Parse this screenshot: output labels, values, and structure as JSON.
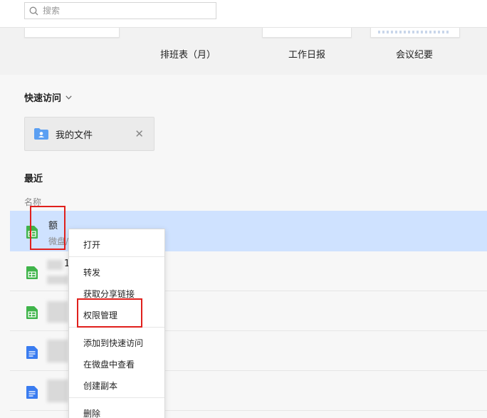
{
  "search": {
    "placeholder": "搜索"
  },
  "templates": [
    {
      "label": "排班表（月）"
    },
    {
      "label": "工作日报"
    },
    {
      "label": "会议纪要"
    }
  ],
  "quick_access": {
    "title": "快速访问",
    "items": [
      {
        "name": "我的文件"
      }
    ]
  },
  "recent": {
    "title": "最近",
    "column_name": "名称",
    "files": [
      {
        "name": "额",
        "location": "微盘/",
        "type": "sheet"
      },
      {
        "name": "1",
        "location": "",
        "type": "sheet"
      },
      {
        "name": "",
        "location": "",
        "type": "sheet"
      },
      {
        "name": "",
        "location": "",
        "type": "doc"
      },
      {
        "name": "",
        "location": "",
        "type": "doc"
      }
    ]
  },
  "context_menu": {
    "items": [
      "打开",
      "转发",
      "获取分享链接",
      "权限管理",
      "添加到快速访问",
      "在微盘中查看",
      "创建副本",
      "删除"
    ]
  },
  "colors": {
    "selected_row": "#cfe2ff",
    "highlight": "#e0201c",
    "sheet_icon": "#3fb44a",
    "doc_icon": "#3a7cf0",
    "folder_icon": "#5b9ff2"
  }
}
